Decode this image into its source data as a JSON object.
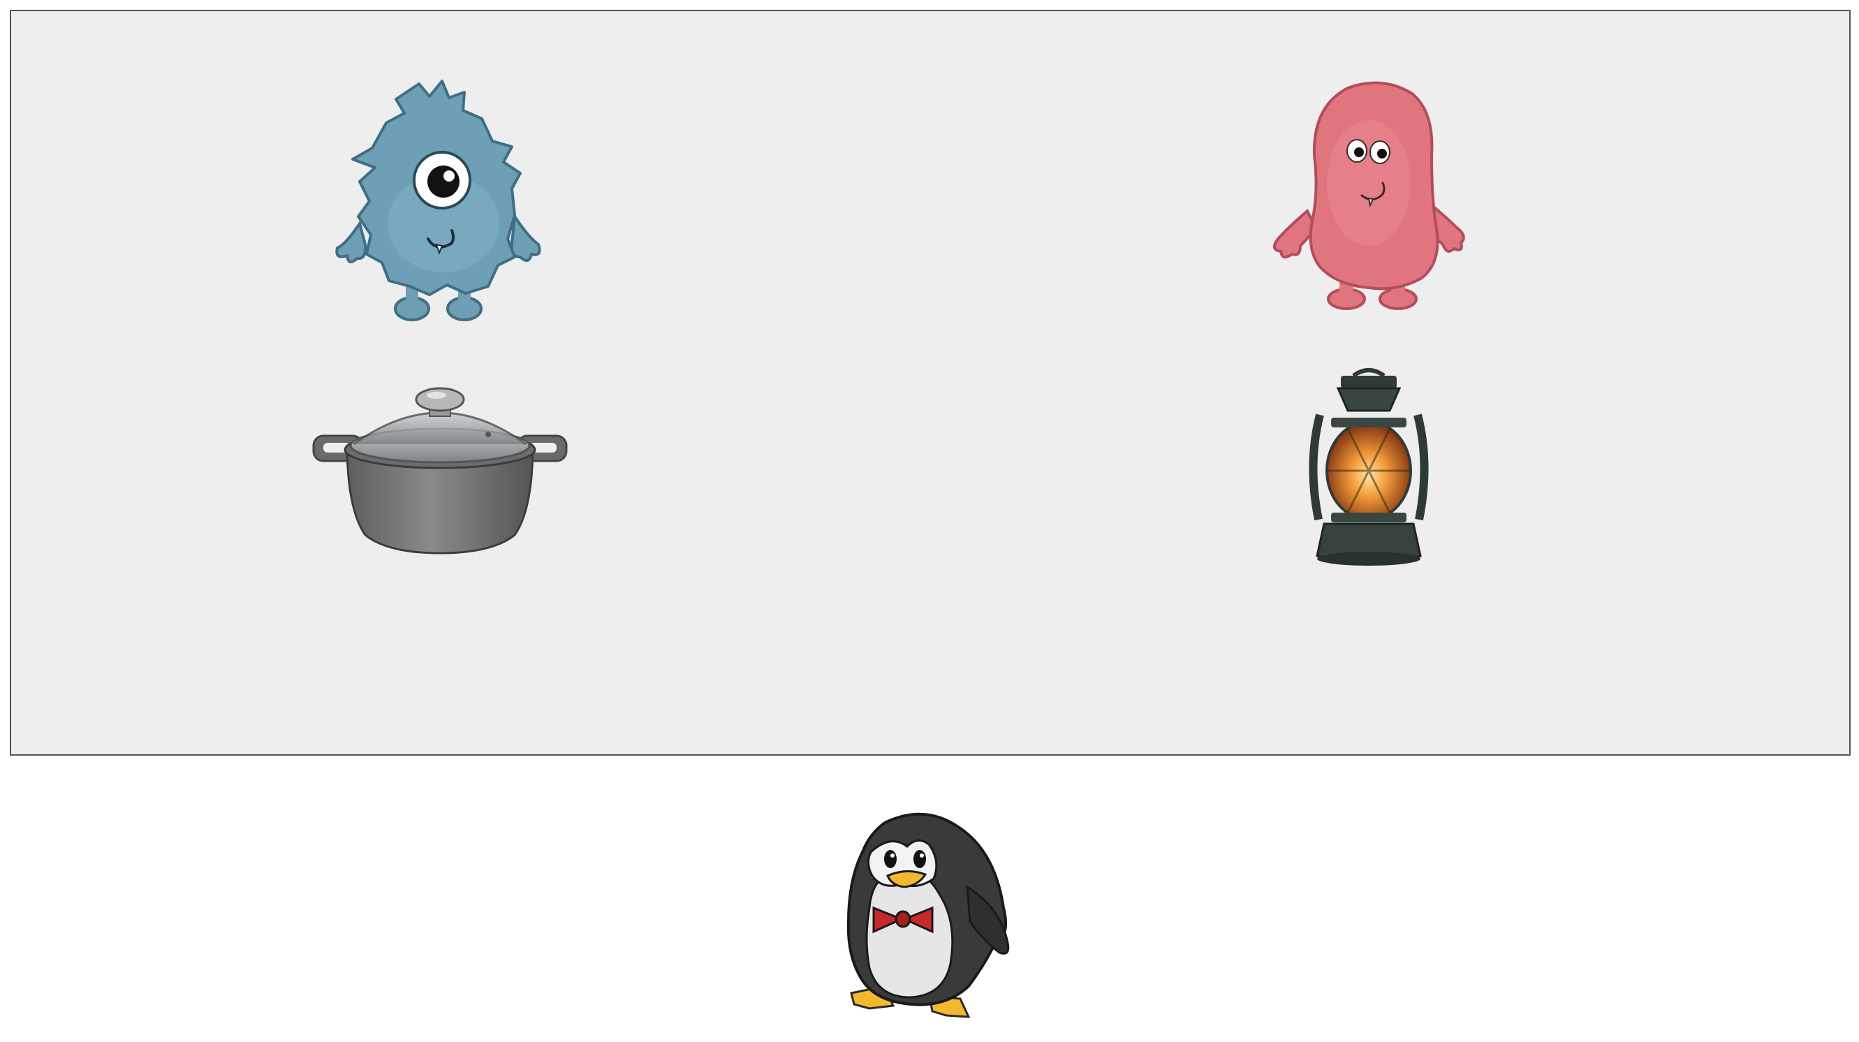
{
  "scene": {
    "board_color": "#eeeeee",
    "board_border_color": "#555555",
    "background_color": "#ffffff"
  },
  "sprites": {
    "blue_monster": {
      "name": "blue-cyclops-monster",
      "color": "#6e9fb5"
    },
    "pink_monster": {
      "name": "pink-blob-monster",
      "color": "#e07580"
    },
    "pot": {
      "name": "cooking-pot-with-lid",
      "color": "#7a7a7a"
    },
    "lantern": {
      "name": "oil-lantern",
      "color": "#2f3a36"
    },
    "penguin": {
      "name": "penguin-with-bow-tie",
      "color": "#3a3a3a"
    }
  }
}
